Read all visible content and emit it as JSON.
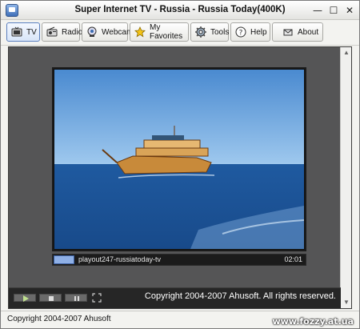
{
  "window": {
    "title": "Super Internet TV - Russia - Russia Today(400K)",
    "minimize_glyph": "—",
    "maximize_glyph": "☐",
    "close_glyph": "✕"
  },
  "toolbar": {
    "items": [
      {
        "label": "TV",
        "icon": "tv-icon",
        "active": true
      },
      {
        "label": "Radio",
        "icon": "radio-icon",
        "active": false
      },
      {
        "label": "Webcam",
        "icon": "webcam-icon",
        "active": false
      },
      {
        "label": "My Favorites",
        "icon": "star-icon",
        "active": false
      },
      {
        "label": "Tools",
        "icon": "gear-icon",
        "active": false
      },
      {
        "label": "Help",
        "icon": "help-icon",
        "active": false
      },
      {
        "label": "About",
        "icon": "info-icon",
        "active": false
      }
    ]
  },
  "player": {
    "channel_text": "playout247-russiatoday-tv",
    "time": "02:01",
    "copyright": "Copyright 2004-2007 Ahusoft. All rights reserved."
  },
  "status": {
    "text": "Copyright 2004-2007 Ahusoft"
  },
  "watermark": {
    "text": "www.fozzy.at.ua"
  },
  "colors": {
    "accent": "#5a7fbf",
    "sea": "#2d64a8",
    "sky": "#5a9ad8"
  }
}
